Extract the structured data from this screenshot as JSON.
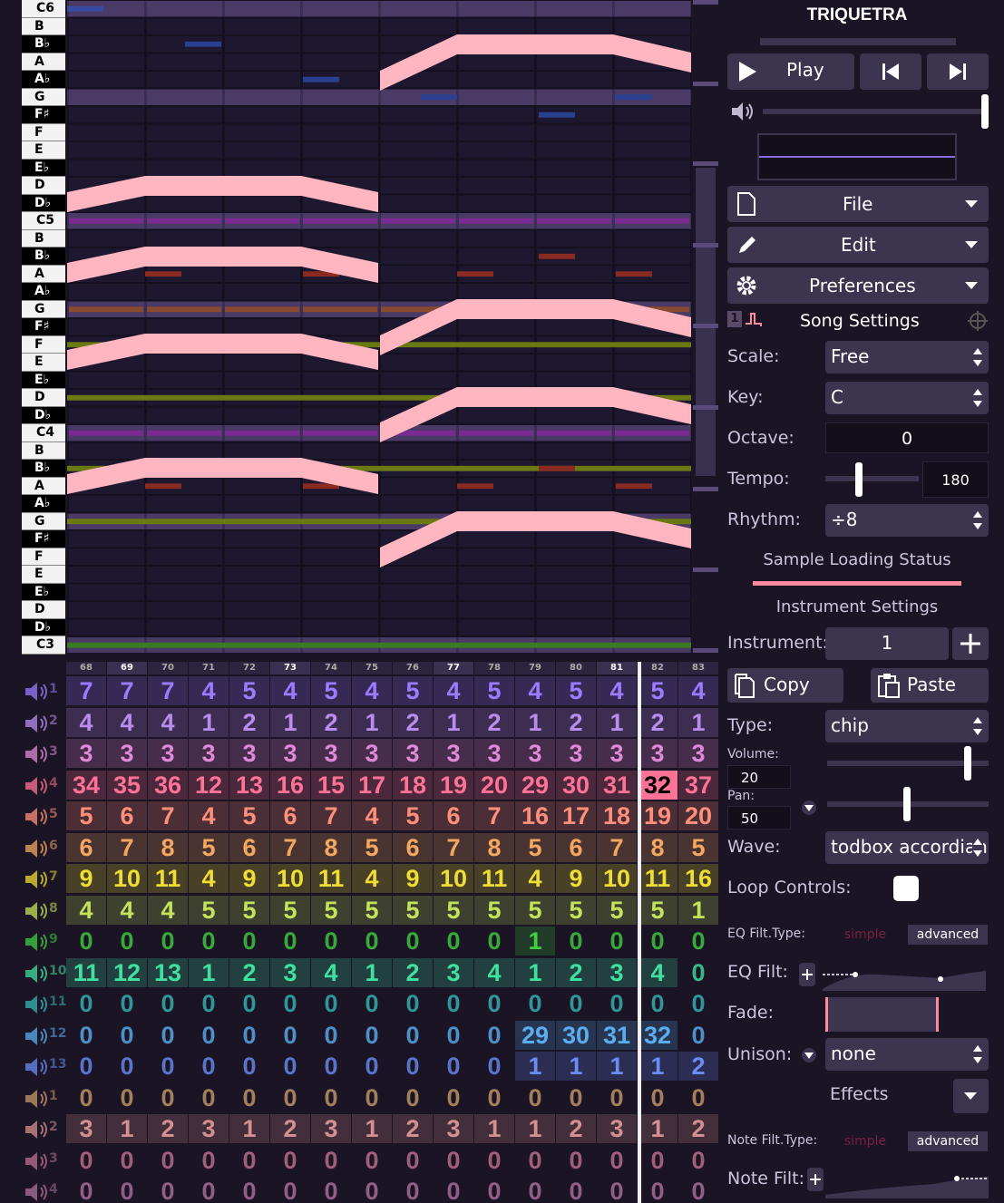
{
  "piano_keys": [
    {
      "label": "C6",
      "type": "c"
    },
    {
      "label": "B",
      "type": "w"
    },
    {
      "label": "B♭",
      "type": "b"
    },
    {
      "label": "A",
      "type": "w"
    },
    {
      "label": "A♭",
      "type": "b"
    },
    {
      "label": "G",
      "type": "w"
    },
    {
      "label": "F♯",
      "type": "b"
    },
    {
      "label": "F",
      "type": "w"
    },
    {
      "label": "E",
      "type": "w"
    },
    {
      "label": "E♭",
      "type": "b"
    },
    {
      "label": "D",
      "type": "w"
    },
    {
      "label": "D♭",
      "type": "b"
    },
    {
      "label": "C5",
      "type": "c"
    },
    {
      "label": "B",
      "type": "w"
    },
    {
      "label": "B♭",
      "type": "b"
    },
    {
      "label": "A",
      "type": "w"
    },
    {
      "label": "A♭",
      "type": "b"
    },
    {
      "label": "G",
      "type": "w"
    },
    {
      "label": "F♯",
      "type": "b"
    },
    {
      "label": "F",
      "type": "w"
    },
    {
      "label": "E",
      "type": "w"
    },
    {
      "label": "E♭",
      "type": "b"
    },
    {
      "label": "D",
      "type": "w"
    },
    {
      "label": "D♭",
      "type": "b"
    },
    {
      "label": "C4",
      "type": "c"
    },
    {
      "label": "B",
      "type": "w"
    },
    {
      "label": "B♭",
      "type": "b"
    },
    {
      "label": "A",
      "type": "w"
    },
    {
      "label": "A♭",
      "type": "b"
    },
    {
      "label": "G",
      "type": "w"
    },
    {
      "label": "F♯",
      "type": "b"
    },
    {
      "label": "F",
      "type": "w"
    },
    {
      "label": "E",
      "type": "w"
    },
    {
      "label": "E♭",
      "type": "b"
    },
    {
      "label": "D",
      "type": "w"
    },
    {
      "label": "D♭",
      "type": "b"
    },
    {
      "label": "C3",
      "type": "c"
    }
  ],
  "bar_numbers": [
    "68",
    "69",
    "70",
    "71",
    "72",
    "73",
    "74",
    "75",
    "76",
    "77",
    "78",
    "79",
    "80",
    "81",
    "82",
    "83"
  ],
  "highlighted_bars": [
    "69",
    "73",
    "77",
    "81"
  ],
  "channels": [
    {
      "num": "1",
      "color": "#9b7bff",
      "values": [
        "7",
        "7",
        "7",
        "4",
        "5",
        "4",
        "5",
        "4",
        "5",
        "4",
        "5",
        "4",
        "5",
        "4",
        "5",
        "4"
      ]
    },
    {
      "num": "2",
      "color": "#b98cf0",
      "values": [
        "4",
        "4",
        "4",
        "1",
        "2",
        "1",
        "2",
        "1",
        "2",
        "1",
        "2",
        "1",
        "2",
        "1",
        "2",
        "1"
      ]
    },
    {
      "num": "3",
      "color": "#e089d8",
      "values": [
        "3",
        "3",
        "3",
        "3",
        "3",
        "3",
        "3",
        "3",
        "3",
        "3",
        "3",
        "3",
        "3",
        "3",
        "3",
        "3"
      ]
    },
    {
      "num": "4",
      "color": "#ff7296",
      "values": [
        "34",
        "35",
        "36",
        "12",
        "13",
        "16",
        "15",
        "17",
        "18",
        "19",
        "20",
        "29",
        "30",
        "31",
        "32",
        "37"
      ]
    },
    {
      "num": "5",
      "color": "#ff8f7a",
      "values": [
        "5",
        "6",
        "7",
        "4",
        "5",
        "6",
        "7",
        "4",
        "5",
        "6",
        "7",
        "16",
        "17",
        "18",
        "19",
        "20"
      ]
    },
    {
      "num": "6",
      "color": "#f4a760",
      "values": [
        "6",
        "7",
        "8",
        "5",
        "6",
        "7",
        "8",
        "5",
        "6",
        "7",
        "8",
        "5",
        "6",
        "7",
        "8",
        "5"
      ]
    },
    {
      "num": "7",
      "color": "#eedd33",
      "values": [
        "9",
        "10",
        "11",
        "4",
        "9",
        "10",
        "11",
        "4",
        "9",
        "10",
        "11",
        "4",
        "9",
        "10",
        "11",
        "16"
      ]
    },
    {
      "num": "8",
      "color": "#c4e35a",
      "values": [
        "4",
        "4",
        "4",
        "5",
        "5",
        "5",
        "5",
        "5",
        "5",
        "5",
        "5",
        "5",
        "5",
        "5",
        "5",
        "1"
      ]
    },
    {
      "num": "9",
      "color": "#3fcf3f",
      "values": [
        "0",
        "0",
        "0",
        "0",
        "0",
        "0",
        "0",
        "0",
        "0",
        "0",
        "0",
        "1",
        "0",
        "0",
        "0",
        "0"
      ]
    },
    {
      "num": "10",
      "color": "#40e0a0",
      "values": [
        "11",
        "12",
        "13",
        "1",
        "2",
        "3",
        "4",
        "1",
        "2",
        "3",
        "4",
        "1",
        "2",
        "3",
        "4",
        "0"
      ]
    },
    {
      "num": "11",
      "color": "#35b8b8",
      "values": [
        "0",
        "0",
        "0",
        "0",
        "0",
        "0",
        "0",
        "0",
        "0",
        "0",
        "0",
        "0",
        "0",
        "0",
        "0",
        "0"
      ]
    },
    {
      "num": "12",
      "color": "#5aaef0",
      "values": [
        "0",
        "0",
        "0",
        "0",
        "0",
        "0",
        "0",
        "0",
        "0",
        "0",
        "0",
        "29",
        "30",
        "31",
        "32",
        "0"
      ]
    },
    {
      "num": "13",
      "color": "#6a8cf5",
      "values": [
        "0",
        "0",
        "0",
        "0",
        "0",
        "0",
        "0",
        "0",
        "0",
        "0",
        "0",
        "1",
        "1",
        "1",
        "1",
        "2"
      ]
    },
    {
      "num": "1",
      "color": "#c79a6a",
      "values": [
        "0",
        "0",
        "0",
        "0",
        "0",
        "0",
        "0",
        "0",
        "0",
        "0",
        "0",
        "0",
        "0",
        "0",
        "0",
        "0"
      ]
    },
    {
      "num": "2",
      "color": "#d49090",
      "values": [
        "3",
        "1",
        "2",
        "3",
        "1",
        "2",
        "3",
        "1",
        "2",
        "3",
        "1",
        "1",
        "2",
        "3",
        "1",
        "2"
      ]
    },
    {
      "num": "3",
      "color": "#c07090",
      "values": [
        "0",
        "0",
        "0",
        "0",
        "0",
        "0",
        "0",
        "0",
        "0",
        "0",
        "0",
        "0",
        "0",
        "0",
        "0",
        "0"
      ]
    },
    {
      "num": "4",
      "color": "#b070a0",
      "values": [
        "0",
        "0",
        "0",
        "0",
        "0",
        "0",
        "0",
        "0",
        "0",
        "0",
        "0",
        "0",
        "0",
        "0",
        "0",
        "0"
      ]
    }
  ],
  "panel": {
    "title": "TRIQUETRA",
    "play_label": "Play",
    "file_label": "File",
    "edit_label": "Edit",
    "preferences_label": "Preferences",
    "song_settings_label": "Song Settings",
    "song_settings_num": "1",
    "scale_label": "Scale:",
    "scale_value": "Free",
    "key_label": "Key:",
    "key_value": "C",
    "octave_label": "Octave:",
    "octave_value": "0",
    "tempo_label": "Tempo:",
    "tempo_value": "180",
    "rhythm_label": "Rhythm:",
    "rhythm_value": "÷8",
    "sample_loading_label": "Sample Loading Status",
    "instrument_settings_label": "Instrument Settings",
    "instrument_label": "Instrument:",
    "instrument_value": "1",
    "copy_label": "Copy",
    "paste_label": "Paste",
    "type_label": "Type:",
    "type_value": "chip",
    "volume_label": "Volume:",
    "volume_value": "20",
    "pan_label": "Pan:",
    "pan_value": "50",
    "wave_label": "Wave:",
    "wave_value": "todbox accordian",
    "loop_controls_label": "Loop Controls:",
    "eq_filt_type_label": "EQ Filt.Type:",
    "eq_filt_label": "EQ Filt:",
    "simple_label": "simple",
    "advanced_label": "advanced",
    "fade_label": "Fade:",
    "unison_label": "Unison:",
    "unison_value": "none",
    "effects_label": "Effects",
    "note_filt_type_label": "Note Filt.Type:",
    "note_filt_label": "Note Filt:"
  },
  "colors": {
    "accent": "#ffb6c1",
    "panel_bg": "#1a1424",
    "button_bg": "#3d3450",
    "playhead": "#f0f0f0"
  }
}
